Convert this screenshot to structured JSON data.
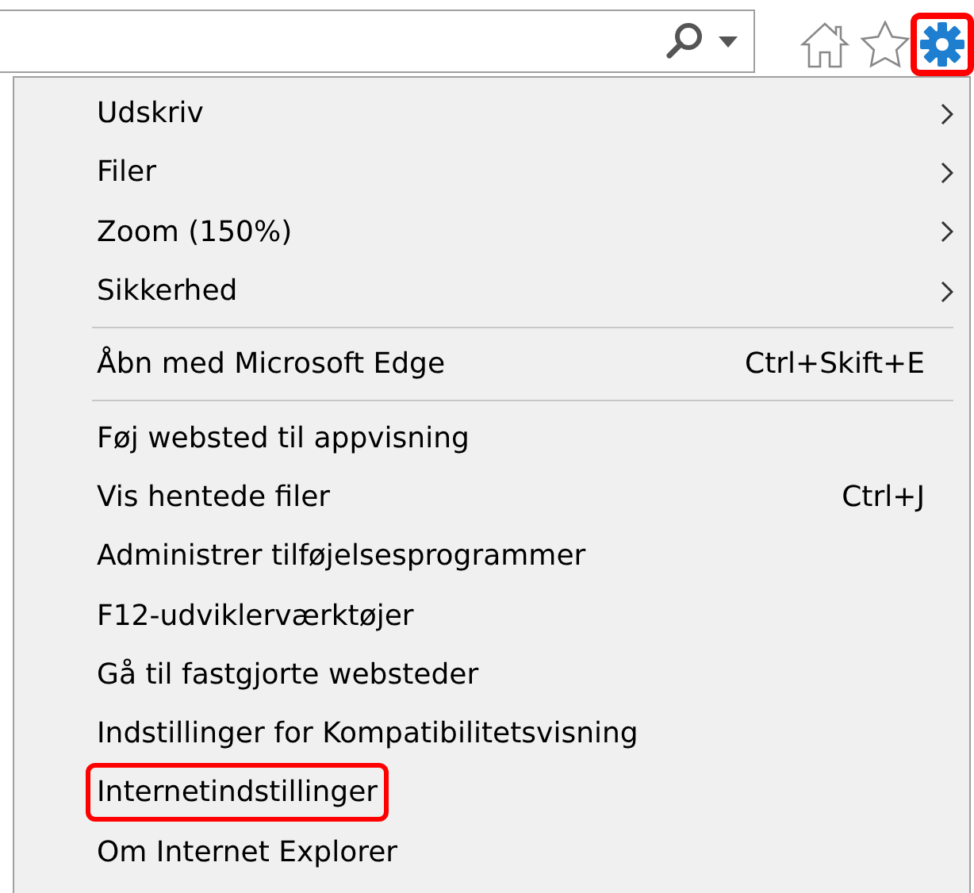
{
  "toolbar": {
    "settings_highlighted": true
  },
  "menu": {
    "groups": [
      {
        "items": [
          {
            "label": "Udskriv",
            "submenu": true,
            "highlighted": false
          },
          {
            "label": "Filer",
            "submenu": true,
            "highlighted": false
          },
          {
            "label": "Zoom (150%)",
            "submenu": true,
            "highlighted": false
          },
          {
            "label": "Sikkerhed",
            "submenu": true,
            "highlighted": false
          }
        ]
      },
      {
        "items": [
          {
            "label": "Åbn med Microsoft Edge",
            "shortcut": "Ctrl+Skift+E",
            "submenu": false,
            "highlighted": false
          }
        ]
      },
      {
        "items": [
          {
            "label": "Føj websted til appvisning",
            "submenu": false,
            "highlighted": false
          },
          {
            "label": "Vis hentede filer",
            "shortcut": "Ctrl+J",
            "submenu": false,
            "highlighted": false
          },
          {
            "label": "Administrer tilføjelsesprogrammer",
            "submenu": false,
            "highlighted": false
          },
          {
            "label": "F12-udviklerværktøjer",
            "submenu": false,
            "highlighted": false
          },
          {
            "label": "Gå til fastgjorte websteder",
            "submenu": false,
            "highlighted": false
          },
          {
            "label": "Indstillinger for Kompatibilitetsvisning",
            "submenu": false,
            "highlighted": false
          },
          {
            "label": "Internetindstillinger",
            "submenu": false,
            "highlighted": true
          },
          {
            "label": "Om Internet Explorer",
            "submenu": false,
            "highlighted": false
          }
        ]
      }
    ]
  }
}
